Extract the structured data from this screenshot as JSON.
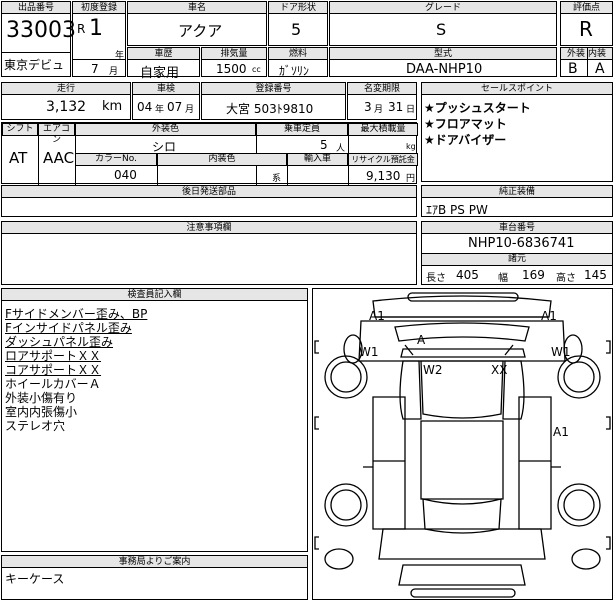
{
  "row1": {
    "lot_header": "出品番号",
    "lot": "33003",
    "reg_header": "初度登録",
    "reg_era": "R",
    "reg_year": "1",
    "year_unit": "年",
    "reg_month": "7",
    "month_unit": "月",
    "venue": "東京デビュ",
    "car_name_header": "車名",
    "car_name": "アクア",
    "doors_header": "ドア形状",
    "doors": "5",
    "grade_header": "グレード",
    "grade": "S",
    "score_header": "評価点",
    "score": "R",
    "history_header": "車歴",
    "history": "自家用",
    "displacement_header": "排気量",
    "displacement": "1500",
    "displacement_unit": "cc",
    "fuel_header": "燃料",
    "fuel": "ｶﾞｿﾘﾝ",
    "model_header": "型式",
    "model": "DAA-NHP10",
    "ext_header": "外装",
    "ext": "B",
    "int_header": "内装",
    "int": "A"
  },
  "row2": {
    "mileage_header": "走行",
    "mileage": "3,132",
    "mileage_unit": "km",
    "inspection_header": "車検",
    "inspection_year": "04",
    "inspection_year_unit": "年",
    "inspection_month": "07",
    "inspection_month_unit": "月",
    "plate_header": "登録番号",
    "plate": "大宮 503ﾄ9810",
    "name_change_header": "名変期限",
    "name_change_month": "3",
    "name_change_month_unit": "月",
    "name_change_day": "31",
    "name_change_day_unit": "日",
    "sales_header": "セールスポイント",
    "sales_points": [
      "★プッシュスタート",
      "★フロアマット",
      "★ドアバイザー"
    ]
  },
  "row3": {
    "shift_header": "シフト",
    "shift": "AT",
    "ac_header": "エアコン",
    "ac": "AAC",
    "color_header": "外装色",
    "color": "シロ",
    "capacity_header": "乗車定員",
    "capacity": "5",
    "capacity_unit": "人",
    "load_header": "最大積載量",
    "load_unit": "kg",
    "color_no_header": "カラーNo.",
    "color_no": "040",
    "int_color_header": "内装色",
    "int_color_unit": "系",
    "import_header": "輸入車",
    "recycle_header": "リサイクル預託金",
    "recycle": "9,130",
    "recycle_unit": "円"
  },
  "parts_header": "後日発送部品",
  "equipment_header": "純正装備",
  "equipment": "ｴｱB PS PW",
  "notes_header": "注意事項欄",
  "chassis_header": "車台番号",
  "chassis": "NHP10-6836741",
  "dims_header": "諸元",
  "dims": {
    "length_label": "長さ",
    "length": "405",
    "width_label": "幅",
    "width": "169",
    "height_label": "高さ",
    "height": "145"
  },
  "inspector_header": "検査員記入欄",
  "inspector_notes": [
    "Fサイドメンバー歪み、BP",
    "Fインサイドパネル歪み",
    "ダッシュパネル歪み",
    "ロアサポートＸＸ",
    "コアサポートＸＸ",
    "ホイールカバーＡ",
    "外装小傷有り",
    "室内内張傷小",
    "ステレオ穴"
  ],
  "office_header": "事務局よりご案内",
  "office_note": "キーケース",
  "diagram": {
    "a1_tl": "A1",
    "a1_tr": "A1",
    "w1_l": "W1",
    "w1_r": "W1",
    "a_front": "A",
    "w2": "W2",
    "xx": "XX",
    "a1_side": "A1"
  }
}
